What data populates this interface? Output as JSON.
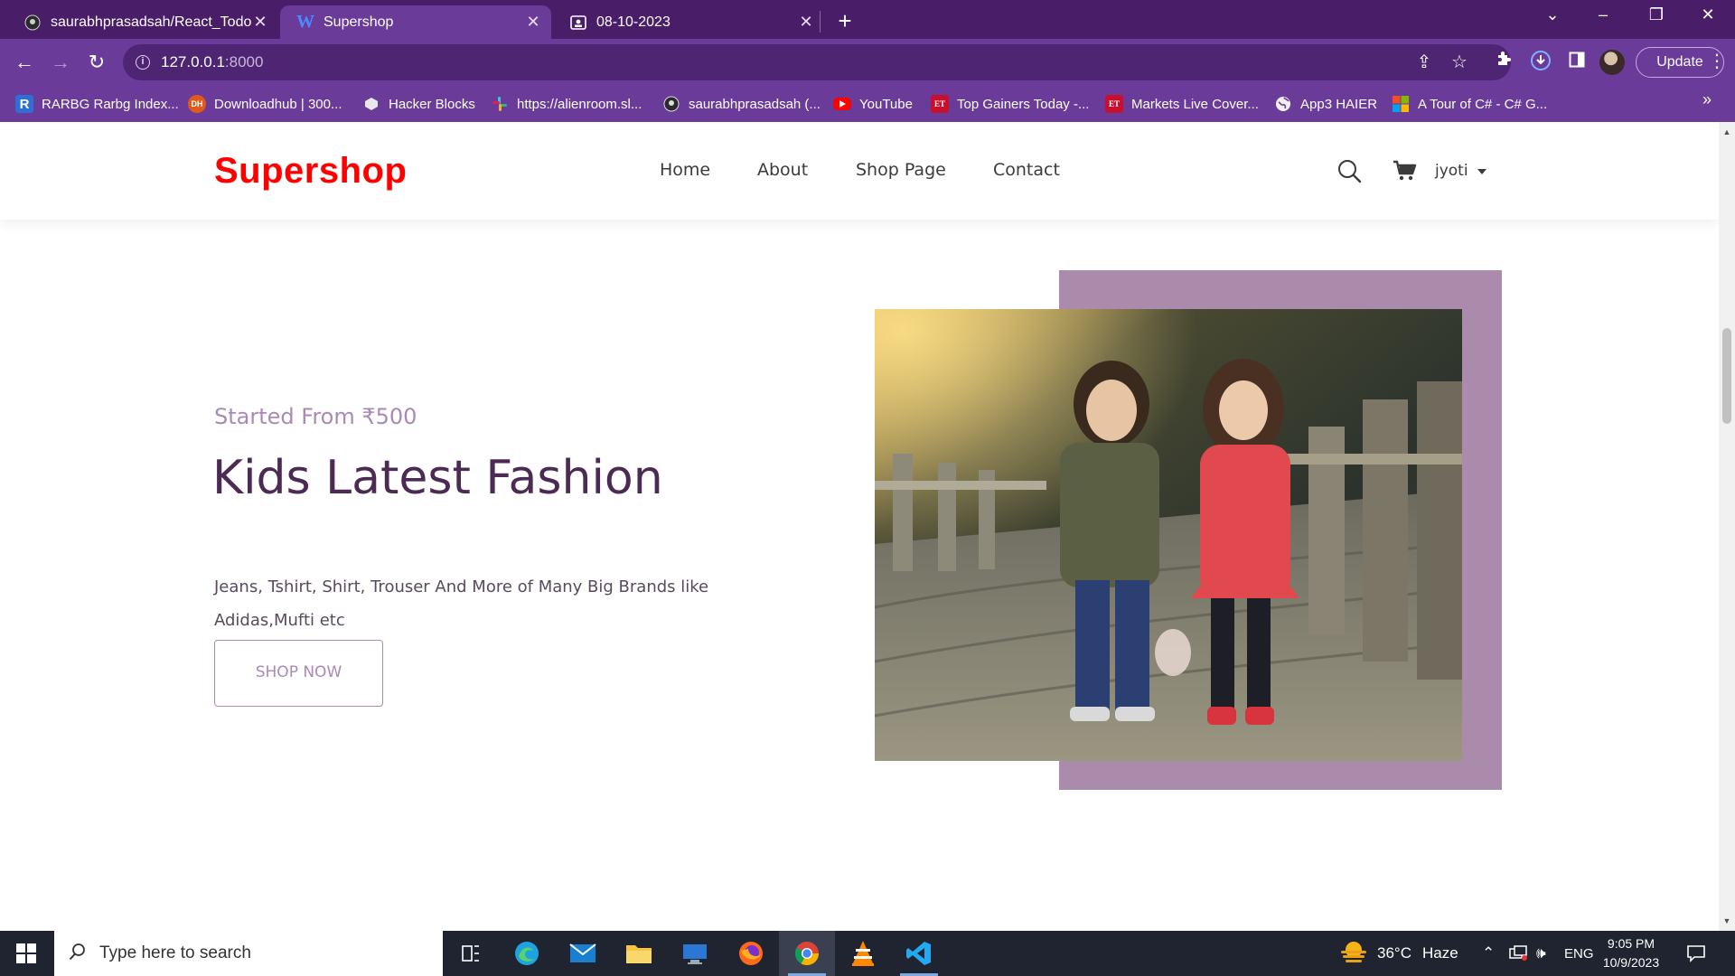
{
  "browser": {
    "tabs": [
      {
        "title": "saurabhprasadsah/React_Todo-A",
        "icon": "github-icon"
      },
      {
        "title": "Supershop",
        "icon": "w-icon"
      },
      {
        "title": "08-10-2023",
        "icon": "document-icon"
      }
    ],
    "url_host": "127.0.0.1",
    "url_port": ":8000",
    "update_label": "Update",
    "bookmarks": [
      {
        "label": "RARBG Rarbg Index...",
        "icon": "r-icon"
      },
      {
        "label": "Downloadhub | 300...",
        "icon": "dh-icon"
      },
      {
        "label": "Hacker Blocks",
        "icon": "hackerblocks-icon"
      },
      {
        "label": "https://alienroom.sl...",
        "icon": "slack-icon"
      },
      {
        "label": "saurabhprasadsah (...",
        "icon": "github-icon"
      },
      {
        "label": "YouTube",
        "icon": "youtube-icon"
      },
      {
        "label": "Top Gainers Today -...",
        "icon": "et-icon"
      },
      {
        "label": "Markets Live Cover...",
        "icon": "et-icon"
      },
      {
        "label": "App3 HAIER",
        "icon": "globe-icon"
      },
      {
        "label": "A Tour of C# - C# G...",
        "icon": "microsoft-icon"
      }
    ]
  },
  "site": {
    "logo": "Supershop",
    "nav": [
      "Home",
      "About",
      "Shop Page",
      "Contact"
    ],
    "user": "jyoti",
    "hero": {
      "subtitle": "Started From ₹500",
      "title": "Kids Latest Fashion",
      "description": "Jeans, Tshirt, Shirt, Trouser And More of Many Big Brands like Adidas,Mufti etc",
      "button": "SHOP NOW"
    },
    "colors": {
      "logo": "#ff0000",
      "accent": "#ab8bab",
      "title": "#4b2a54",
      "subtitle": "#a98ab5"
    }
  },
  "taskbar": {
    "search_placeholder": "Type here to search",
    "weather_temp": "36°C",
    "weather_desc": "Haze",
    "language": "ENG",
    "time": "9:05 PM",
    "date": "10/9/2023"
  }
}
